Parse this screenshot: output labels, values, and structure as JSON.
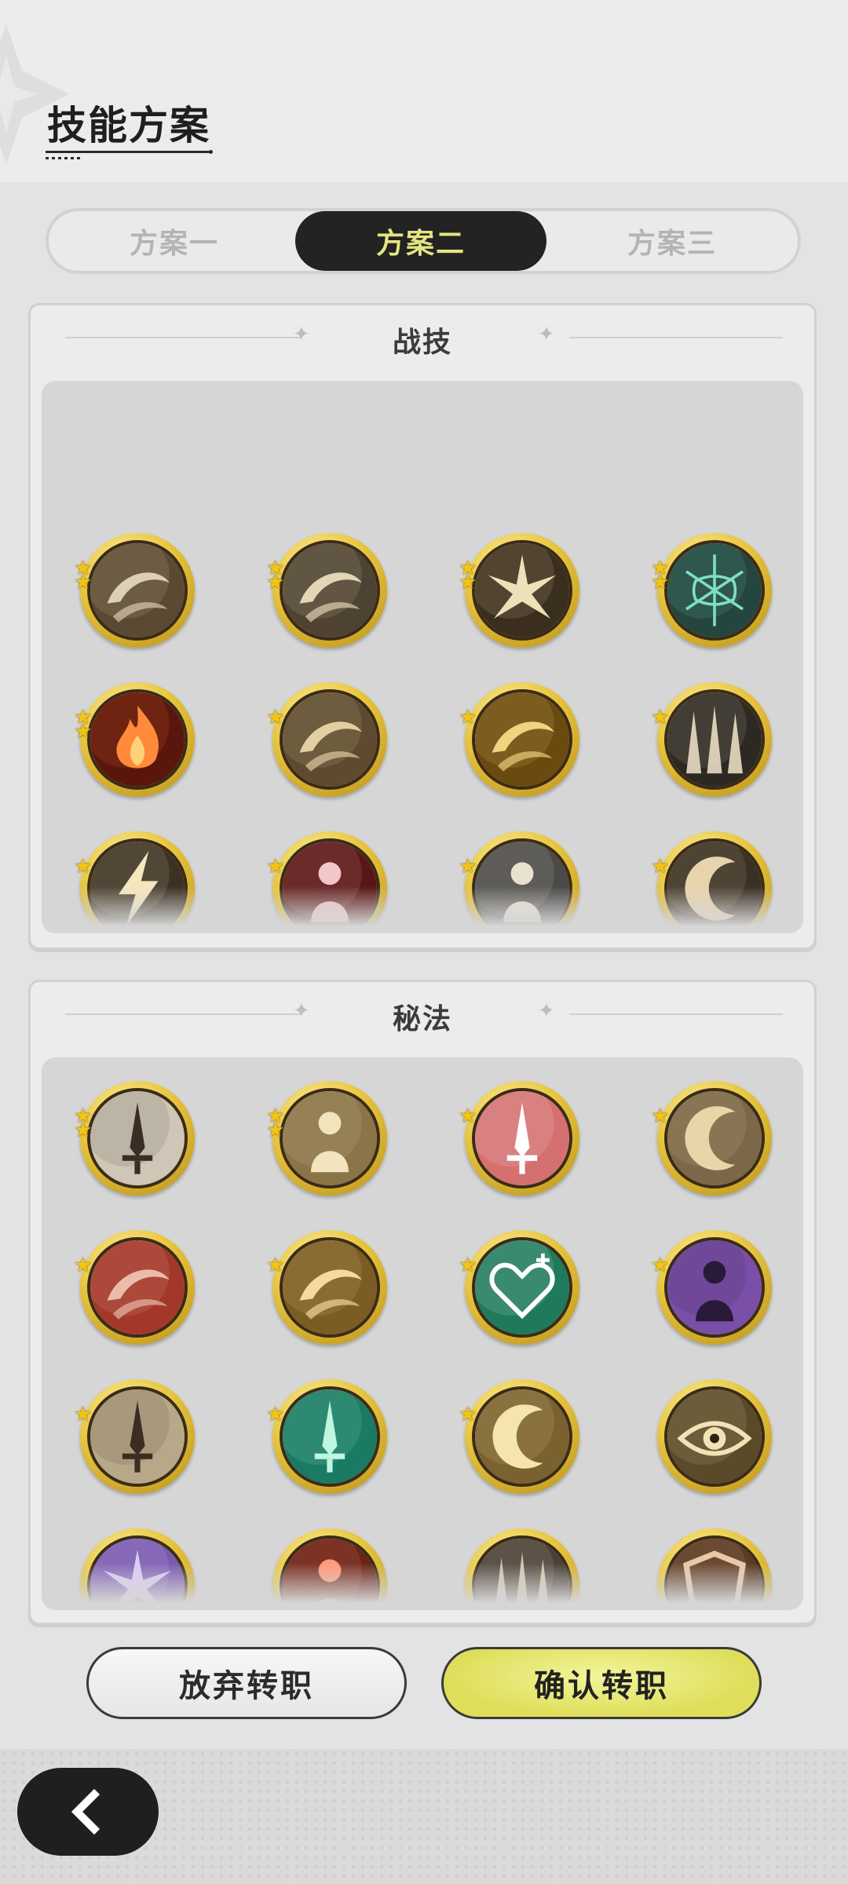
{
  "header": {
    "title": "技能方案"
  },
  "tabs": [
    {
      "label": "方案一",
      "active": false
    },
    {
      "label": "方案二",
      "active": true
    },
    {
      "label": "方案三",
      "active": false
    }
  ],
  "battle_section": {
    "title": "战技",
    "skills": [
      {
        "icon": "wind-slash-icon",
        "stars": 2
      },
      {
        "icon": "whirlwind-icon",
        "stars": 2
      },
      {
        "icon": "light-burst-icon",
        "stars": 2
      },
      {
        "icon": "spiderweb-icon",
        "stars": 2
      },
      {
        "icon": "fire-icon",
        "stars": 2
      },
      {
        "icon": "tornado-icon",
        "stars": 1
      },
      {
        "icon": "golden-vortex-icon",
        "stars": 1
      },
      {
        "icon": "spike-cross-icon",
        "stars": 1
      },
      {
        "icon": "lightning-strike-icon",
        "stars": 1
      },
      {
        "icon": "warrior-sword-icon",
        "stars": 1
      },
      {
        "icon": "multi-shadow-icon",
        "stars": 1
      },
      {
        "icon": "crescent-icon",
        "stars": 1
      }
    ]
  },
  "secret_section": {
    "title": "秘法",
    "skills": [
      {
        "icon": "crystal-blade-icon",
        "stars": 2
      },
      {
        "icon": "armor-icon",
        "stars": 2
      },
      {
        "icon": "heal-sword-icon",
        "stars": 1
      },
      {
        "icon": "shield-dash-icon",
        "stars": 1
      },
      {
        "icon": "scroll-icon",
        "stars": 1
      },
      {
        "icon": "golden-swirl-icon",
        "stars": 1
      },
      {
        "icon": "heart-heal-icon",
        "stars": 1
      },
      {
        "icon": "cat-dash-icon",
        "stars": 1
      },
      {
        "icon": "sword-buff-icon",
        "stars": 1
      },
      {
        "icon": "jade-blade-icon",
        "stars": 1
      },
      {
        "icon": "crescent-guard-icon",
        "stars": 1
      },
      {
        "icon": "eye-icon",
        "stars": 0
      },
      {
        "icon": "purple-gem-icon",
        "stars": 0
      },
      {
        "icon": "red-armor-icon",
        "stars": 0
      },
      {
        "icon": "dark-pillar-icon",
        "stars": 0
      },
      {
        "icon": "brown-shield-icon",
        "stars": 0
      }
    ]
  },
  "buttons": {
    "abandon": "放弃转职",
    "confirm": "确认转职"
  },
  "nav": {
    "back_icon": "back-arrow-icon"
  },
  "colors": {
    "accent_tab_text": "#e4e482",
    "confirm_bg": "#dede5a",
    "ring_gold": "#e8c640"
  }
}
